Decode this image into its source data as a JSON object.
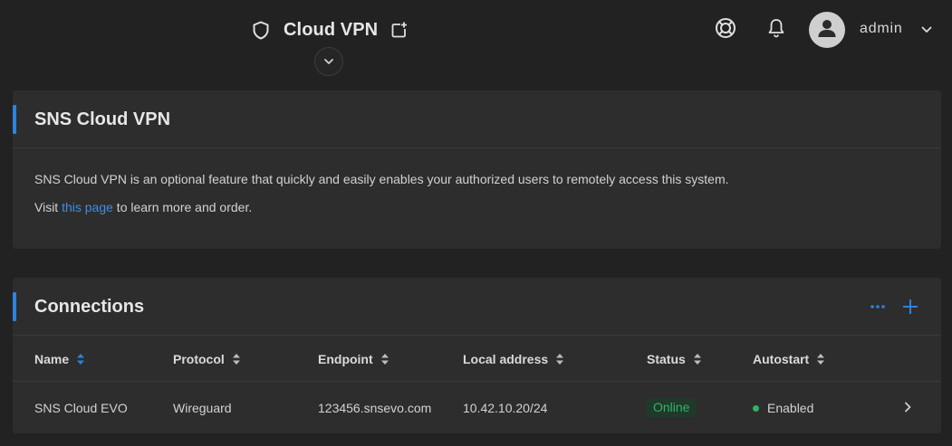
{
  "header": {
    "title": "Cloud VPN",
    "icons": {
      "title": "shield-icon",
      "open": "open-new-window-icon",
      "expand": "chevron-down-icon",
      "help": "lifebuoy-icon",
      "notifications": "bell-icon",
      "avatar": "user-icon",
      "menu": "chevron-down-icon"
    },
    "username": "admin"
  },
  "info_card": {
    "title": "SNS Cloud VPN",
    "description": "SNS Cloud VPN is an optional feature that quickly and easily enables your authorized users to remotely access this system.",
    "visit_prefix": "Visit ",
    "visit_link": "this page",
    "visit_suffix": " to learn more and order."
  },
  "connections": {
    "title": "Connections",
    "actions": {
      "more": "more-horizontal-icon",
      "add": "plus-icon"
    },
    "columns": [
      "Name",
      "Protocol",
      "Endpoint",
      "Local address",
      "Status",
      "Autostart"
    ],
    "rows": [
      {
        "name": "SNS Cloud EVO",
        "protocol": "Wireguard",
        "endpoint": "123456.snsevo.com",
        "local_address": "10.42.10.20/24",
        "status": "Online",
        "autostart": "Enabled"
      }
    ]
  },
  "colors": {
    "accent": "#2d82dc",
    "link": "#3d8ee6",
    "online": "#33b366",
    "background": "#222222",
    "card": "#2d2d2d"
  }
}
